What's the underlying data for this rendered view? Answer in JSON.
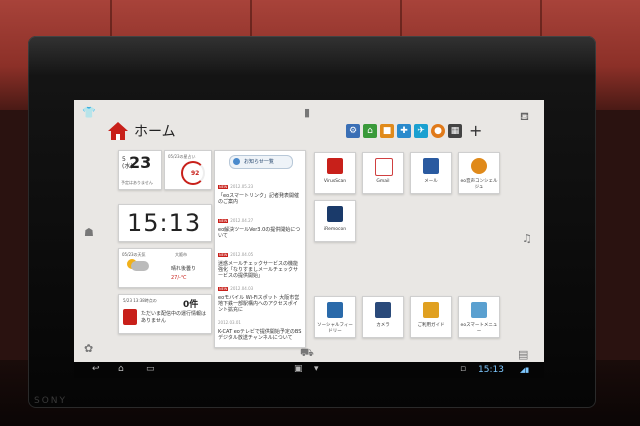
{
  "device": {
    "brand": "SONY"
  },
  "home": {
    "title": "ホーム"
  },
  "shortcuts": [
    {
      "icon": "settings-icon",
      "color": "#3a6fb5"
    },
    {
      "icon": "home-icon",
      "color": "#3a9a3a"
    },
    {
      "icon": "app-icon",
      "color": "#e08a1a"
    },
    {
      "icon": "tools-icon",
      "color": "#2a8acc"
    },
    {
      "icon": "plane-icon",
      "color": "#1aa0d0"
    },
    {
      "icon": "settings-icon",
      "color": "#e07a1a"
    },
    {
      "icon": "grid-icon",
      "color": "#444444"
    }
  ],
  "widgets": {
    "date": {
      "month": "5",
      "weekday": "水",
      "day": "23",
      "note": "予定はありません"
    },
    "calendar": {
      "label": "05/23の星占い",
      "number": "92"
    },
    "clock": {
      "time": "15:13"
    },
    "weather": {
      "label": "05/23の天気",
      "city": "大阪市",
      "desc": "晴れ後曇り",
      "temp": "27/-℃"
    },
    "train": {
      "label": "5/23 13:38時点の",
      "count": "0件",
      "info": "ただいま配信中の運行情報はありません"
    }
  },
  "news": {
    "banner": "お知らせ一覧",
    "items": [
      {
        "badge": "NEW",
        "date": "2012.05.23",
        "text": "「eoスマートリンク」記者発表開催のご案内"
      },
      {
        "badge": "NEW",
        "date": "2012.04.27",
        "text": "eo解決ツールVer3.0の提供開始について"
      },
      {
        "badge": "NEW",
        "date": "2012.04.05",
        "text": "迷惑メールチェックサービスの機能強化「なりすましメールチェックサービスの提供開始」"
      },
      {
        "badge": "NEW",
        "date": "2012.04.03",
        "text": "eoモバイル Wi-Fiスポット 大阪市営地下鉄一部駅構内へのアクセスポイント拡充に"
      },
      {
        "badge": "",
        "date": "2012.03.01",
        "text": "K-CAT eoテレビで提供開始予定のBSデジタル放送チャンネルについて"
      }
    ]
  },
  "apps": [
    {
      "label": "VirusScan",
      "color": "#c8201a"
    },
    {
      "label": "Gmail",
      "color": "#d04040"
    },
    {
      "label": "メール",
      "color": "#2a5aa0"
    },
    {
      "label": "eo音声コンシェルジュ",
      "color": "#e08a1a"
    },
    {
      "label": "iRemocon",
      "color": "#1a3a6a"
    },
    {
      "label": "ソーシャルフィードリー",
      "color": "#2a6aaa"
    },
    {
      "label": "カメラ",
      "color": "#2a4a7a"
    },
    {
      "label": "ご利用ガイド",
      "color": "#e0a020"
    },
    {
      "label": "eoスマートメニュー",
      "color": "#5aa0d0"
    }
  ],
  "system": {
    "time": "15:13"
  }
}
